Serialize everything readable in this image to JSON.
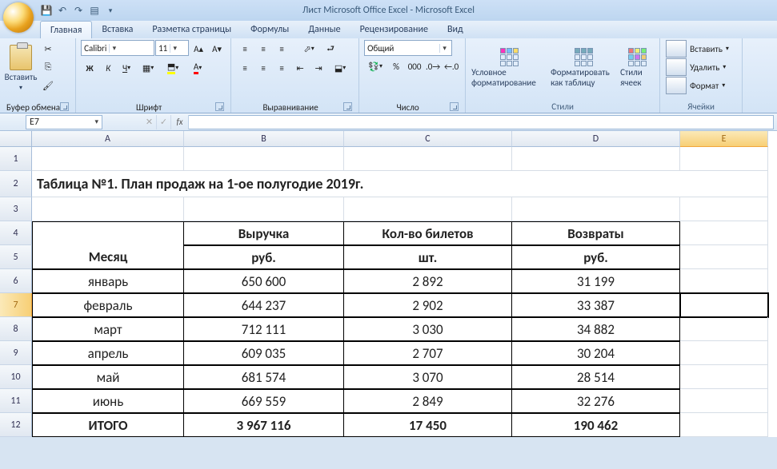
{
  "app": {
    "title": "Лист Microsoft Office Excel - Microsoft Excel"
  },
  "qat": {
    "save": "save-icon",
    "undo": "undo-icon",
    "redo": "redo-icon",
    "print": "print-icon"
  },
  "tabs": {
    "home": "Главная",
    "insert": "Вставка",
    "page_layout": "Разметка страницы",
    "formulas": "Формулы",
    "data": "Данные",
    "review": "Рецензирование",
    "view": "Вид"
  },
  "ribbon": {
    "clipboard": {
      "paste": "Вставить",
      "label": "Буфер обмена"
    },
    "font": {
      "name": "Calibri",
      "size": "11",
      "label": "Шрифт"
    },
    "alignment": {
      "label": "Выравнивание"
    },
    "number": {
      "format": "Общий",
      "label": "Число"
    },
    "styles": {
      "cond": "Условное форматирование",
      "table": "Форматировать как таблицу",
      "cell": "Стили ячеек",
      "label": "Стили"
    },
    "cells": {
      "insert": "Вставить",
      "delete": "Удалить",
      "format": "Формат",
      "label": "Ячейки"
    }
  },
  "namebox": "E7",
  "sheet": {
    "cols": [
      "A",
      "B",
      "C",
      "D",
      "E"
    ],
    "title": "Таблица №1. План продаж на 1-ое полугодие 2019г.",
    "head1": {
      "a": "Месяц",
      "b": "Выручка",
      "c": "Кол-во билетов",
      "d": "Возвраты"
    },
    "head2": {
      "b": "руб.",
      "c": "шт.",
      "d": "руб."
    },
    "rows": [
      {
        "r": "6",
        "a": "январь",
        "b": "650 600",
        "c": "2 892",
        "d": "31 199"
      },
      {
        "r": "7",
        "a": "февраль",
        "b": "644 237",
        "c": "2 902",
        "d": "33 387"
      },
      {
        "r": "8",
        "a": "март",
        "b": "712 111",
        "c": "3 030",
        "d": "34 882"
      },
      {
        "r": "9",
        "a": "апрель",
        "b": "609 035",
        "c": "2 707",
        "d": "30 204"
      },
      {
        "r": "10",
        "a": "май",
        "b": "681 574",
        "c": "3 070",
        "d": "28 514"
      },
      {
        "r": "11",
        "a": "июнь",
        "b": "669 559",
        "c": "2 849",
        "d": "32 276"
      }
    ],
    "total": {
      "r": "12",
      "a": "ИТОГО",
      "b": "3 967 116",
      "c": "17 450",
      "d": "190 462"
    }
  }
}
